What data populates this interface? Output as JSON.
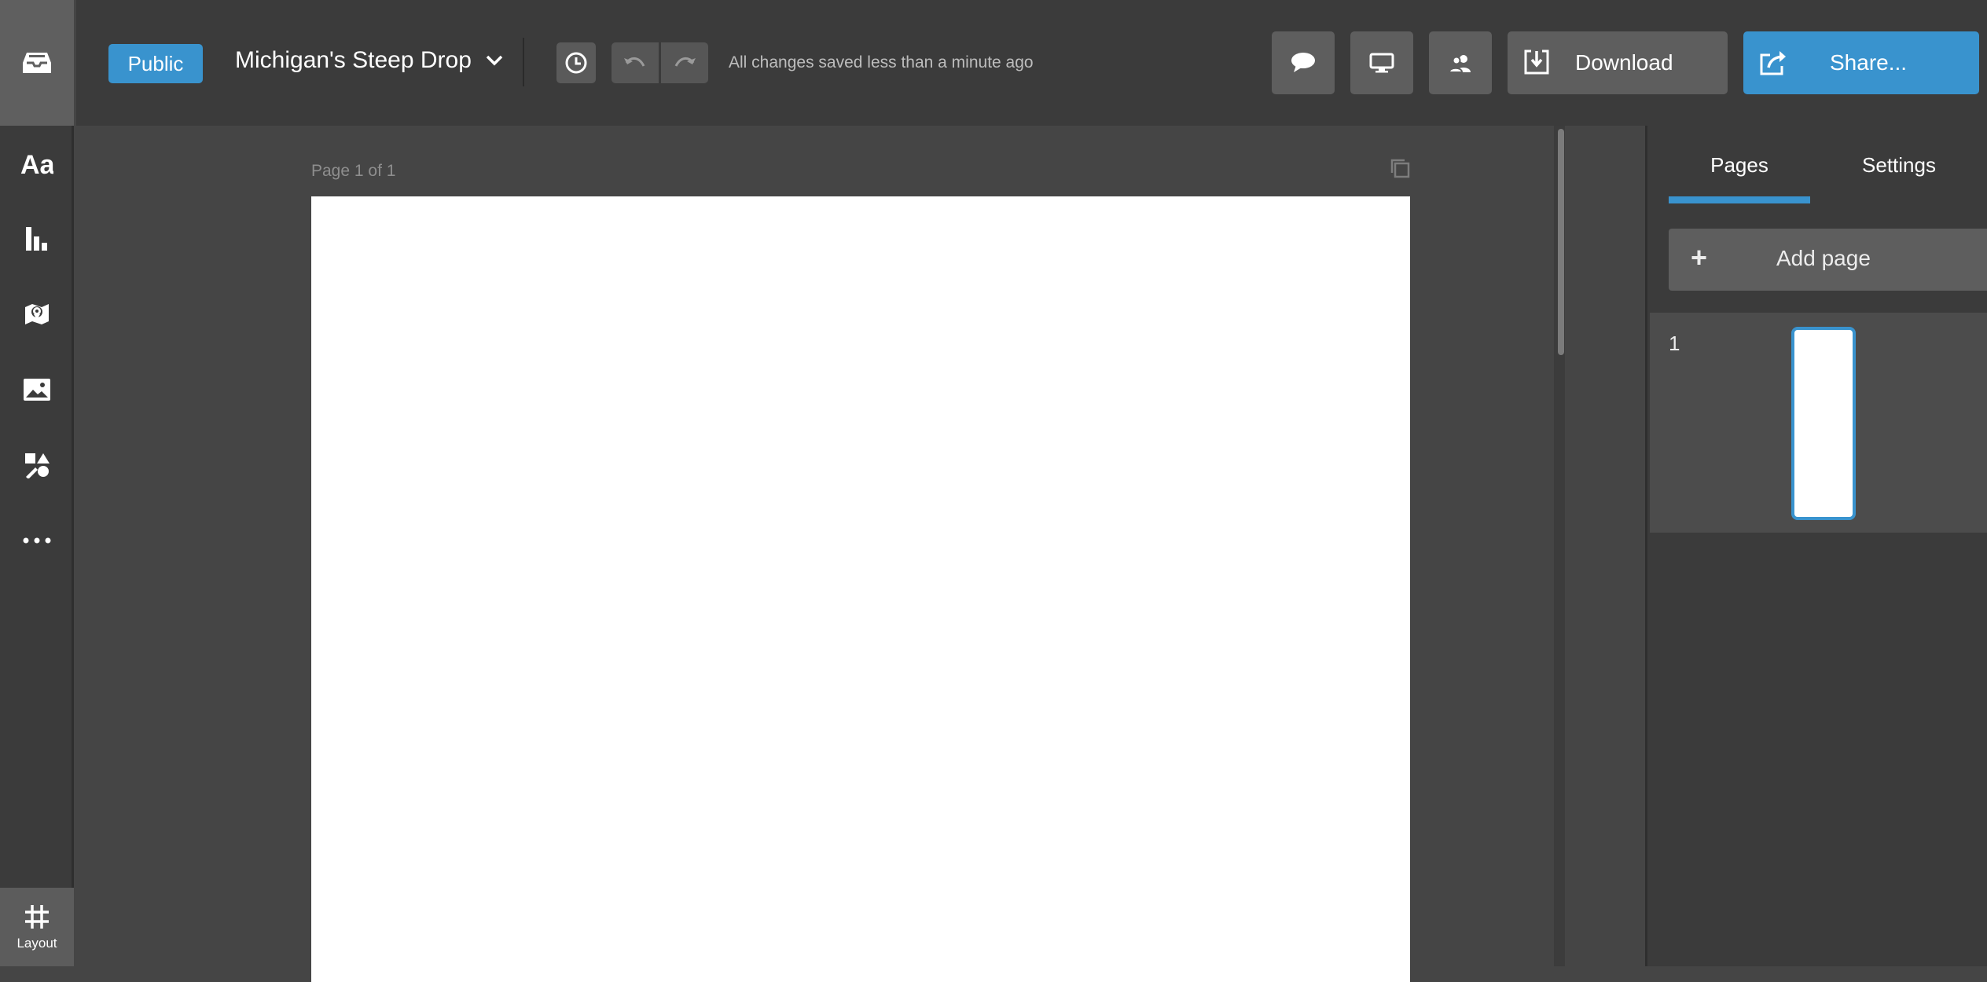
{
  "topbar": {
    "visibility_label": "Public",
    "doc_title": "Michigan's Steep Drop",
    "save_status": "All changes saved less than a minute ago",
    "download_label": "Download",
    "share_label": "Share..."
  },
  "canvas": {
    "page_label": "Page 1 of 1"
  },
  "rail": {
    "layout_label": "Layout"
  },
  "right_panel": {
    "tabs": [
      {
        "label": "Pages"
      },
      {
        "label": "Settings"
      }
    ],
    "add_page_label": "Add page",
    "pages": [
      {
        "number": "1"
      }
    ]
  },
  "colors": {
    "accent": "#3993ce",
    "chrome": "#3b3b3b",
    "canvas": "#454545"
  }
}
